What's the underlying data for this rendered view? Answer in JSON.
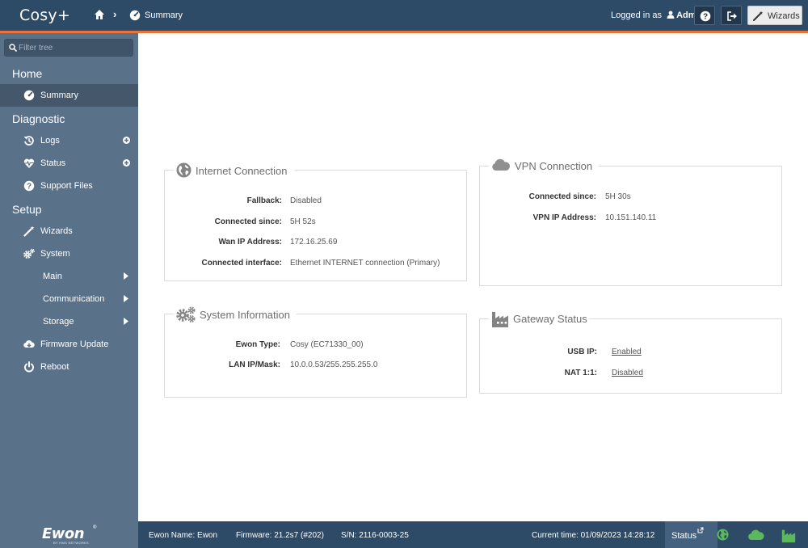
{
  "app": {
    "title": "Cosy+"
  },
  "breadcrumb": {
    "current": "Summary"
  },
  "header": {
    "logged_in_prefix": "Logged in as",
    "user": "Adm",
    "wizards_label": "Wizards"
  },
  "sidebar": {
    "filter_placeholder": "Filter tree",
    "sections": {
      "home": "Home",
      "diagnostic": "Diagnostic",
      "setup": "Setup"
    },
    "items": {
      "summary": "Summary",
      "logs": "Logs",
      "status": "Status",
      "support_files": "Support Files",
      "wizards": "Wizards",
      "system": "System",
      "main": "Main",
      "communication": "Communication",
      "storage": "Storage",
      "firmware_update": "Firmware Update",
      "reboot": "Reboot"
    },
    "logo": {
      "text": "Ewon",
      "reg": "®",
      "sub": "BY HMS NETWORKS"
    }
  },
  "panels": {
    "internet": {
      "title": "Internet Connection",
      "rows": [
        {
          "key": "Fallback:",
          "value": "Disabled"
        },
        {
          "key": "Connected since:",
          "value": "5H 52s"
        },
        {
          "key": "Wan IP Address:",
          "value": "172.16.25.69"
        },
        {
          "key": "Connected interface:",
          "value": "Ethernet INTERNET connection (Primary)"
        }
      ]
    },
    "vpn": {
      "title": "VPN Connection",
      "rows": [
        {
          "key": "Connected since:",
          "value": "5H 30s"
        },
        {
          "key": "VPN IP Address:",
          "value": "10.151.140.11"
        }
      ]
    },
    "system": {
      "title": "System Information",
      "rows": [
        {
          "key": "Ewon Type:",
          "value": "Cosy (EC71330_00)"
        },
        {
          "key": "LAN IP/Mask:",
          "value": "10.0.0.53/255.255.255.0"
        }
      ]
    },
    "gateway": {
      "title": "Gateway Status",
      "rows": [
        {
          "key": "USB IP:",
          "value": "Enabled"
        },
        {
          "key": "NAT 1:1:",
          "value": "Disabled"
        }
      ]
    }
  },
  "footer": {
    "ewon_name": "Ewon Name: Ewon",
    "firmware": "Firmware: 21.2s7 (#202)",
    "serial": "S/N: 2116-0003-25",
    "current_time": "Current time: 01/09/2023 14:28:12",
    "status_label": "Status"
  },
  "colors": {
    "topbar": "#2d4a66",
    "accent": "#e8743b",
    "sidebar": "#5a718a",
    "status_ok": "#5cb85c",
    "link": "#1d2c9a"
  },
  "icons": {
    "breadcrumb": [
      "home-icon",
      "gauge-icon"
    ],
    "header": [
      "user-icon",
      "help-icon",
      "logout-icon",
      "wand-icon"
    ],
    "panels": [
      "globe-icon",
      "cloud-icon",
      "gears-icon",
      "factory-icon"
    ],
    "footer": [
      "external-link-icon",
      "globe-icon",
      "cloud-icon",
      "factory-icon"
    ]
  }
}
